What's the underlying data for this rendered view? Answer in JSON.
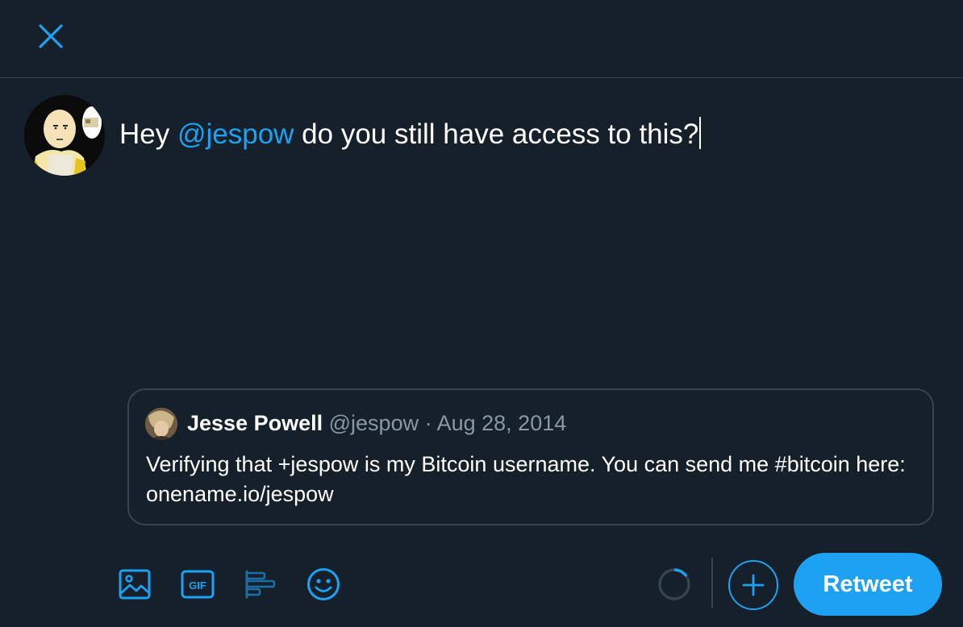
{
  "colors": {
    "background": "#15202b",
    "accent": "#1da1f2",
    "border": "#38444d",
    "muted": "#8899a6",
    "text": "#ffffff"
  },
  "header": {
    "close_icon": "close-icon"
  },
  "composer": {
    "text_before": "Hey ",
    "mention": "@jespow",
    "text_after": " do you still have access to this?"
  },
  "quoted_tweet": {
    "name": "Jesse Powell",
    "handle": "@jespow",
    "separator": " · ",
    "date": "Aug 28, 2014",
    "text": "Verifying that +jespow is my Bitcoin username. You can send me #bitcoin here: onename.io/jespow"
  },
  "toolbar": {
    "icons": [
      "image-icon",
      "gif-icon",
      "poll-icon",
      "emoji-icon"
    ],
    "gif_label": "GIF",
    "add_icon": "plus-icon",
    "retweet_label": "Retweet"
  }
}
